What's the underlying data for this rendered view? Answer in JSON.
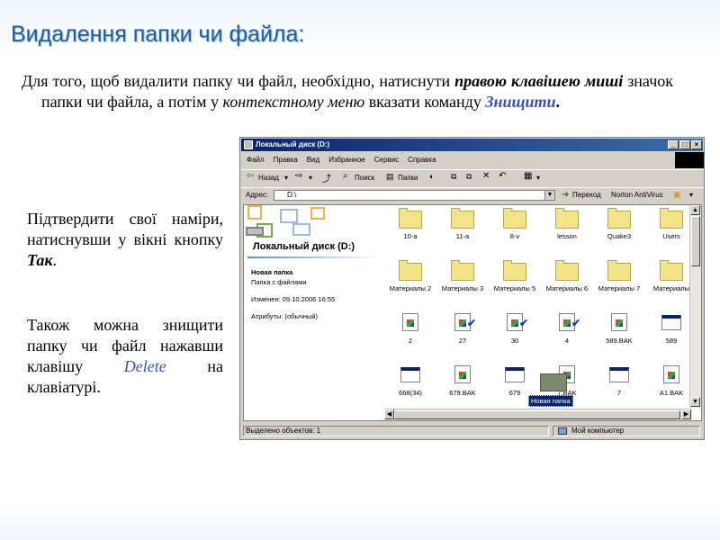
{
  "slide": {
    "title": "Видалення папки чи файла:",
    "intro": {
      "t1": "Для того, щоб видалити папку чи файл, необхідно, натиснути ",
      "t2": "правою клавішею миші",
      "t3": " значок папки чи файла,  а потім у ",
      "t4": "контекстному меню",
      "t5": " вказати команду ",
      "t6": "Знищити",
      "t7": "."
    },
    "confirm": {
      "t1": "Підтвердити свої наміри, натиснувши у вікні кнопку ",
      "t2": "Так",
      "t3": "."
    },
    "keyboard": {
      "t1": "Також можна знищити папку чи файл нажавши клавішу ",
      "t2": "Delete",
      "t3": " на клавіатурі."
    }
  },
  "window": {
    "title": "Локальный диск (D:)",
    "controls": [
      "_",
      "□",
      "×"
    ],
    "menu": [
      "Файл",
      "Правка",
      "Вид",
      "Избранное",
      "Сервис",
      "Справка"
    ],
    "toolbar": {
      "back": "Назад",
      "search": "Поиск",
      "folders": "Папки"
    },
    "address": {
      "label": "Адрес:",
      "value": "D:\\",
      "go": "Переход",
      "norton": "Norton AntiVirus"
    },
    "left_pane": {
      "drive_title": "Локальный диск (D:)",
      "item_name": "Новая папка",
      "item_type": "Папка с файлами",
      "modified": "Изменен: 09.10.2006 16:55",
      "attributes": "Атрибуты: (обычный)"
    },
    "icons_row1": [
      "10-а",
      "11-а",
      "8-v",
      "lesson",
      "Quake3",
      "Users"
    ],
    "icons_row2": [
      "Материалы 2",
      "Материалы 3",
      "Материалы 5",
      "Материалы 6",
      "Материалы 7",
      "Материалы"
    ],
    "icons_row3": [
      "2",
      "27",
      "30",
      "4",
      "589.BAK",
      "589"
    ],
    "icons_row4": [
      "668(34)",
      "679.BAK",
      "679",
      "7.BAK",
      "7",
      "A1.BAK"
    ],
    "drag_label": "Новая папка",
    "status": {
      "selected": "Выделено объектов: 1",
      "location": "Мой компьютер"
    }
  }
}
